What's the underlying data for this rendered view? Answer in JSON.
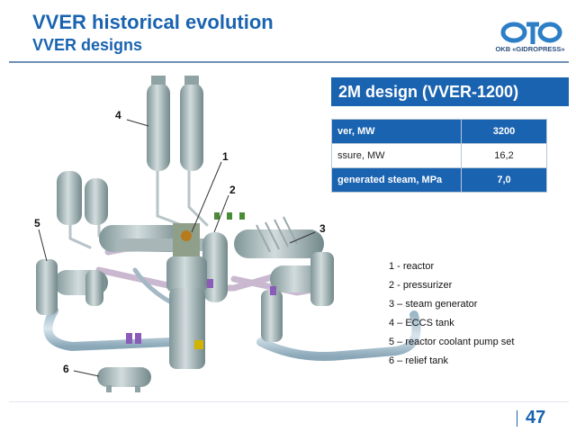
{
  "header": {
    "title": "VVER historical evolution",
    "subtitle": "VVER designs",
    "logo_text": "OKB «GIDROPRESS»"
  },
  "design_title": "2M design (VVER-1200)",
  "params": [
    {
      "label": "ver, MW",
      "value": "3200"
    },
    {
      "label": "ssure, MW",
      "value": "16,2"
    },
    {
      "label": "generated steam, MPa",
      "value": "7,0"
    }
  ],
  "callouts": [
    "1",
    "2",
    "3",
    "4",
    "5",
    "6"
  ],
  "legend": [
    "1 - reactor",
    "2 - pressurizer",
    "3 – steam generator",
    "4 – ECCS tank",
    "5 – reactor coolant pump set",
    "6 – relief tank"
  ],
  "page_number": "47",
  "colors": {
    "accent": "#1a63b0",
    "equipment": "#9fb3b5",
    "pipes": "#c9b8cf"
  }
}
